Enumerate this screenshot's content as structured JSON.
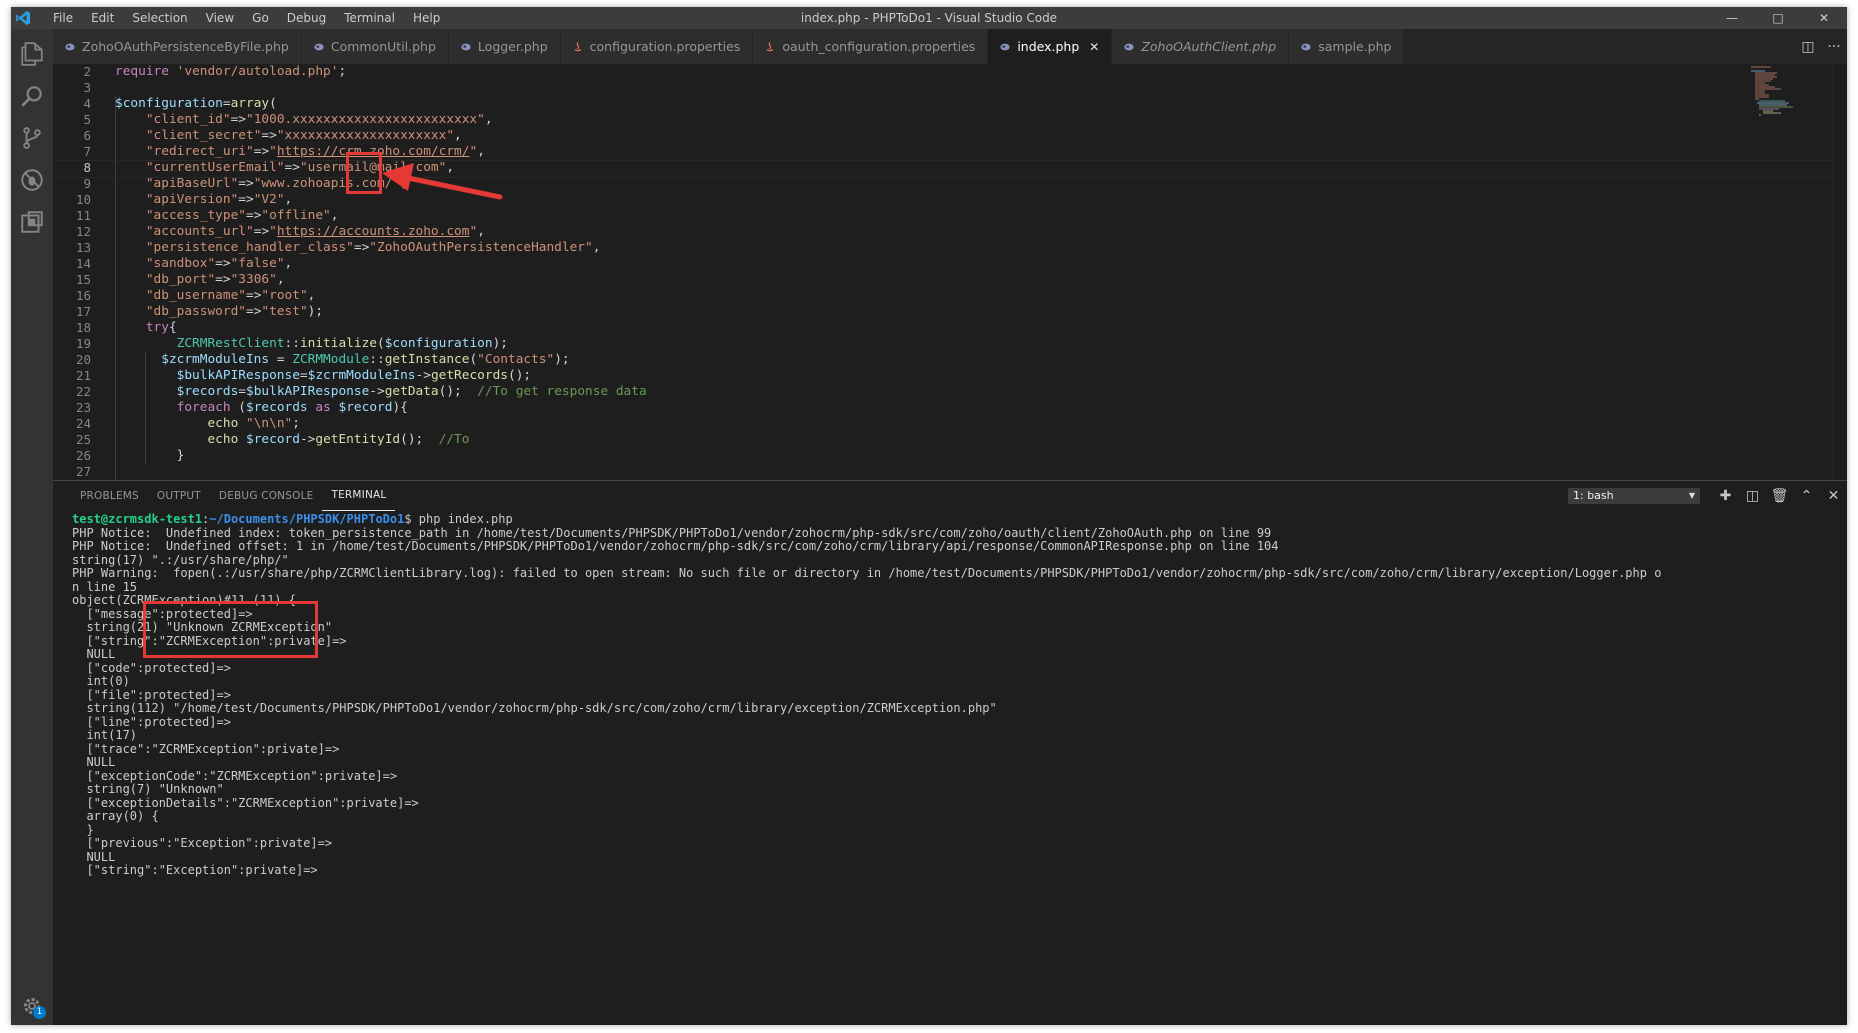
{
  "window": {
    "title": "index.php - PHPToDo1 - Visual Studio Code",
    "menu": [
      "File",
      "Edit",
      "Selection",
      "View",
      "Go",
      "Debug",
      "Terminal",
      "Help"
    ]
  },
  "activity_icons": [
    "explorer-icon",
    "search-icon",
    "source-control-icon",
    "debug-icon",
    "extensions-icon",
    "settings-gear-icon"
  ],
  "settings_badge": "1",
  "tabs": [
    {
      "label": "ZohoOAuthPersistenceByFile.php",
      "icon": "php-icon",
      "active": false,
      "italic": false
    },
    {
      "label": "CommonUtil.php",
      "icon": "php-icon",
      "active": false,
      "italic": false
    },
    {
      "label": "Logger.php",
      "icon": "php-icon",
      "active": false,
      "italic": false
    },
    {
      "label": "configuration.properties",
      "icon": "java-icon",
      "active": false,
      "italic": false
    },
    {
      "label": "oauth_configuration.properties",
      "icon": "java-icon",
      "active": false,
      "italic": false
    },
    {
      "label": "index.php",
      "icon": "php-icon",
      "active": true,
      "italic": false
    },
    {
      "label": "ZohoOAuthClient.php",
      "icon": "php-icon",
      "active": false,
      "italic": true
    },
    {
      "label": "sample.php",
      "icon": "php-icon",
      "active": false,
      "italic": false
    }
  ],
  "editor": {
    "line_numbers": [
      "2",
      "3",
      "4",
      "5",
      "6",
      "7",
      "8",
      "9",
      "10",
      "11",
      "12",
      "13",
      "14",
      "15",
      "16",
      "17",
      "18",
      "19",
      "20",
      "21",
      "22",
      "23",
      "24",
      "25",
      "26",
      "27"
    ],
    "current_line": "8",
    "lines": [
      [
        [
          "kw",
          "require"
        ],
        [
          "pun",
          " "
        ],
        [
          "str",
          "'vendor/autoload.php'"
        ],
        [
          "pun",
          ";"
        ]
      ],
      [],
      [
        [
          "var",
          "$configuration"
        ],
        [
          "pun",
          "="
        ],
        [
          "fn",
          "array"
        ],
        [
          "pun",
          "("
        ]
      ],
      [
        [
          "pun",
          "    "
        ],
        [
          "str",
          "\"client_id\""
        ],
        [
          "pun",
          "=>"
        ],
        [
          "str",
          "\"1000.xxxxxxxxxxxxxxxxxxxxxxxx\""
        ],
        [
          "pun",
          ","
        ]
      ],
      [
        [
          "pun",
          "    "
        ],
        [
          "str",
          "\"client_secret\""
        ],
        [
          "pun",
          "=>"
        ],
        [
          "str",
          "\"xxxxxxxxxxxxxxxxxxxxx\""
        ],
        [
          "pun",
          ","
        ]
      ],
      [
        [
          "pun",
          "    "
        ],
        [
          "str",
          "\"redirect_uri\""
        ],
        [
          "pun",
          "=>"
        ],
        [
          "str",
          "\""
        ],
        [
          "url",
          "https://crm.zoho.com/crm/"
        ],
        [
          "str",
          "\""
        ],
        [
          "pun",
          ","
        ]
      ],
      [
        [
          "pun",
          "    "
        ],
        [
          "str",
          "\"currentUserEmail\""
        ],
        [
          "pun",
          "=>"
        ],
        [
          "str",
          "\"usermail@mail.com\""
        ],
        [
          "pun",
          ","
        ]
      ],
      [
        [
          "pun",
          "    "
        ],
        [
          "str",
          "\"apiBaseUrl\""
        ],
        [
          "pun",
          "=>"
        ],
        [
          "str",
          "\"www.zohoapis.com/\""
        ],
        [
          "pun",
          ","
        ]
      ],
      [
        [
          "pun",
          "    "
        ],
        [
          "str",
          "\"apiVersion\""
        ],
        [
          "pun",
          "=>"
        ],
        [
          "str",
          "\"V2\""
        ],
        [
          "pun",
          ","
        ]
      ],
      [
        [
          "pun",
          "    "
        ],
        [
          "str",
          "\"access_type\""
        ],
        [
          "pun",
          "=>"
        ],
        [
          "str",
          "\"offline\""
        ],
        [
          "pun",
          ","
        ]
      ],
      [
        [
          "pun",
          "    "
        ],
        [
          "str",
          "\"accounts_url\""
        ],
        [
          "pun",
          "=>"
        ],
        [
          "str",
          "\""
        ],
        [
          "url",
          "https://accounts.zoho.com"
        ],
        [
          "str",
          "\""
        ],
        [
          "pun",
          ","
        ]
      ],
      [
        [
          "pun",
          "    "
        ],
        [
          "str",
          "\"persistence_handler_class\""
        ],
        [
          "pun",
          "=>"
        ],
        [
          "str",
          "\"ZohoOAuthPersistenceHandler\""
        ],
        [
          "pun",
          ","
        ]
      ],
      [
        [
          "pun",
          "    "
        ],
        [
          "str",
          "\"sandbox\""
        ],
        [
          "pun",
          "=>"
        ],
        [
          "str",
          "\"false\""
        ],
        [
          "pun",
          ","
        ]
      ],
      [
        [
          "pun",
          "    "
        ],
        [
          "str",
          "\"db_port\""
        ],
        [
          "pun",
          "=>"
        ],
        [
          "str",
          "\"3306\""
        ],
        [
          "pun",
          ","
        ]
      ],
      [
        [
          "pun",
          "    "
        ],
        [
          "str",
          "\"db_username\""
        ],
        [
          "pun",
          "=>"
        ],
        [
          "str",
          "\"root\""
        ],
        [
          "pun",
          ","
        ]
      ],
      [
        [
          "pun",
          "    "
        ],
        [
          "str",
          "\"db_password\""
        ],
        [
          "pun",
          "=>"
        ],
        [
          "str",
          "\"test\""
        ],
        [
          "pun",
          ");"
        ]
      ],
      [
        [
          "pun",
          "    "
        ],
        [
          "kw",
          "try"
        ],
        [
          "pun",
          "{"
        ]
      ],
      [
        [
          "pun",
          "        "
        ],
        [
          "cls",
          "ZCRMRestClient"
        ],
        [
          "pun",
          "::"
        ],
        [
          "fn",
          "initialize"
        ],
        [
          "pun",
          "("
        ],
        [
          "var",
          "$configuration"
        ],
        [
          "pun",
          ");"
        ]
      ],
      [
        [
          "pun",
          "      "
        ],
        [
          "var",
          "$zcrmModuleIns"
        ],
        [
          "pun",
          " = "
        ],
        [
          "cls",
          "ZCRMModule"
        ],
        [
          "pun",
          "::"
        ],
        [
          "fn",
          "getInstance"
        ],
        [
          "pun",
          "("
        ],
        [
          "str",
          "\"Contacts\""
        ],
        [
          "pun",
          ");"
        ]
      ],
      [
        [
          "pun",
          "        "
        ],
        [
          "var",
          "$bulkAPIResponse"
        ],
        [
          "pun",
          "="
        ],
        [
          "var",
          "$zcrmModuleIns"
        ],
        [
          "pun",
          "->"
        ],
        [
          "fn",
          "getRecords"
        ],
        [
          "pun",
          "();"
        ]
      ],
      [
        [
          "pun",
          "        "
        ],
        [
          "var",
          "$records"
        ],
        [
          "pun",
          "="
        ],
        [
          "var",
          "$bulkAPIResponse"
        ],
        [
          "pun",
          "->"
        ],
        [
          "fn",
          "getData"
        ],
        [
          "pun",
          "();  "
        ],
        [
          "cmt",
          "//To get response data"
        ]
      ],
      [
        [
          "pun",
          "        "
        ],
        [
          "kw",
          "foreach"
        ],
        [
          "pun",
          " ("
        ],
        [
          "var",
          "$records"
        ],
        [
          "pun",
          " "
        ],
        [
          "kw",
          "as"
        ],
        [
          "pun",
          " "
        ],
        [
          "var",
          "$record"
        ],
        [
          "pun",
          "){"
        ]
      ],
      [
        [
          "pun",
          "            "
        ],
        [
          "fn",
          "echo"
        ],
        [
          "pun",
          " "
        ],
        [
          "str",
          "\"\\n\\n\""
        ],
        [
          "pun",
          ";"
        ]
      ],
      [
        [
          "pun",
          "            "
        ],
        [
          "fn",
          "echo"
        ],
        [
          "pun",
          " "
        ],
        [
          "var",
          "$record"
        ],
        [
          "pun",
          "->"
        ],
        [
          "fn",
          "getEntityId"
        ],
        [
          "pun",
          "();  "
        ],
        [
          "cmt",
          "//To"
        ]
      ],
      [
        [
          "pun",
          "        }"
        ]
      ],
      []
    ]
  },
  "panel": {
    "tabs": [
      "PROBLEMS",
      "OUTPUT",
      "DEBUG CONSOLE",
      "TERMINAL"
    ],
    "active_tab": "TERMINAL",
    "terminal_select": "1: bash",
    "action_icons": [
      "add-terminal-icon",
      "split-terminal-icon",
      "trash-icon",
      "maximize-panel-icon",
      "close-panel-icon"
    ]
  },
  "terminal": {
    "prompt_user": "test@zcrmsdk-test1",
    "prompt_path": "~/Documents/PHPSDK/PHPToDo1",
    "command": "$ php index.php",
    "output": [
      "PHP Notice:  Undefined index: token_persistence_path in /home/test/Documents/PHPSDK/PHPToDo1/vendor/zohocrm/php-sdk/src/com/zoho/oauth/client/ZohoOAuth.php on line 99",
      "PHP Notice:  Undefined offset: 1 in /home/test/Documents/PHPSDK/PHPToDo1/vendor/zohocrm/php-sdk/src/com/zoho/crm/library/api/response/CommonAPIResponse.php on line 104",
      "string(17) \".:/usr/share/php/\"",
      "PHP Warning:  fopen(.:/usr/share/php/ZCRMClientLibrary.log): failed to open stream: No such file or directory in /home/test/Documents/PHPSDK/PHPToDo1/vendor/zohocrm/php-sdk/src/com/zoho/crm/library/exception/Logger.php o",
      "n line 15",
      "object(ZCRMException)#11 (11) {",
      "  [\"message\":protected]=>",
      "  string(21) \"Unknown ZCRMException\"",
      "  [\"string\":\"ZCRMException\":private]=>",
      "  NULL",
      "  [\"code\":protected]=>",
      "  int(0)",
      "  [\"file\":protected]=>",
      "  string(112) \"/home/test/Documents/PHPSDK/PHPToDo1/vendor/zohocrm/php-sdk/src/com/zoho/crm/library/exception/ZCRMException.php\"",
      "  [\"line\":protected]=>",
      "  int(17)",
      "  [\"trace\":\"ZCRMException\":private]=>",
      "  NULL",
      "  [\"exceptionCode\":\"ZCRMException\":private]=>",
      "  string(7) \"Unknown\"",
      "  [\"exceptionDetails\":\"ZCRMException\":private]=>",
      "  array(0) {",
      "  }",
      "  [\"previous\":\"Exception\":private]=>",
      "  NULL",
      "  [\"string\":\"Exception\":private]=>"
    ]
  },
  "annotation_color": "#e53935"
}
